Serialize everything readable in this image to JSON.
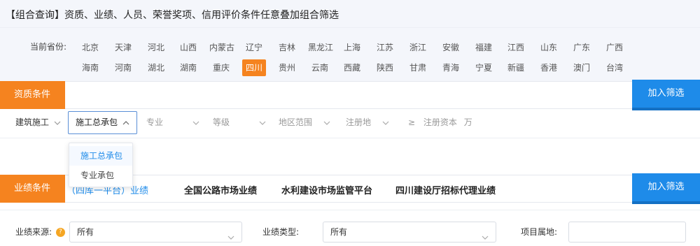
{
  "header": {
    "title": "【组合查询】资质、业绩、人员、荣誉奖项、信用评价条件任意叠加组合筛选"
  },
  "province": {
    "label": "当前省份:",
    "row1": [
      "北京",
      "天津",
      "河北",
      "山西",
      "内蒙古",
      "辽宁",
      "吉林",
      "黑龙江",
      "上海",
      "江苏",
      "浙江",
      "安徽",
      "福建",
      "江西",
      "山东",
      "广东",
      "广西"
    ],
    "row2": [
      "海南",
      "河南",
      "湖北",
      "湖南",
      "重庆",
      "四川",
      "贵州",
      "云南",
      "西藏",
      "陕西",
      "甘肃",
      "青海",
      "宁夏",
      "新疆",
      "香港",
      "澳门",
      "台湾"
    ],
    "selected": "四川"
  },
  "qualification": {
    "tag": "资质条件",
    "add_button": "加入筛选",
    "filters": {
      "category": "建筑施工",
      "type": "施工总承包",
      "major": "专业",
      "grade": "等级",
      "region": "地区范围",
      "reg_place": "注册地",
      "capital_prefix": "≥",
      "capital_label": "注册资本",
      "capital_unit": "万"
    },
    "dropdown_options": [
      "施工总承包",
      "专业承包"
    ]
  },
  "performance": {
    "tag": "业绩条件",
    "add_button": "加入筛选",
    "tabs": [
      "（四库一平台）业绩",
      "全国公路市场业绩",
      "水利建设市场监管平台",
      "四川建设厅招标代理业绩"
    ],
    "help_icon": "?",
    "fields": {
      "source_label": "业绩来源:",
      "source_value": "所有",
      "type_label": "业绩类型:",
      "type_value": "所有",
      "location_label": "项目属地:",
      "location_value": ""
    }
  },
  "colors": {
    "accent_orange": "#f5831f",
    "primary_blue": "#1e8be9"
  }
}
